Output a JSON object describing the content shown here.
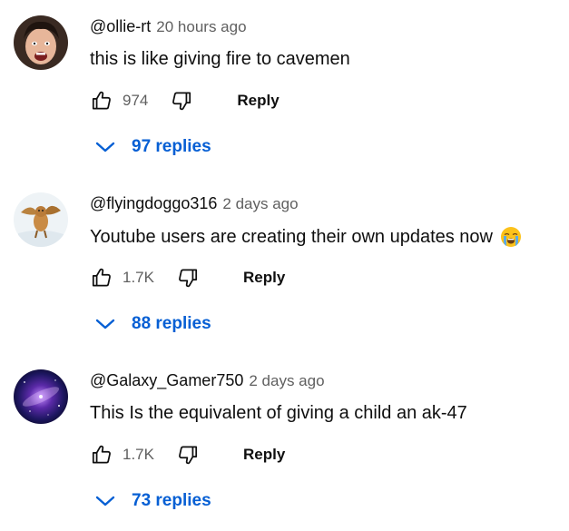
{
  "comments": [
    {
      "author": "@ollie-rt",
      "time": "20 hours ago",
      "text": "this is like giving fire to cavemen",
      "likes": "974",
      "reply_label": "Reply",
      "replies_label": "97 replies",
      "avatar_icon": "face-photo-avatar"
    },
    {
      "author": "@flyingdoggo316",
      "time": "2 days ago",
      "text": "Youtube users are creating their own updates now",
      "emoji": "loudly-crying-face-emoji",
      "likes": "1.7K",
      "reply_label": "Reply",
      "replies_label": "88 replies",
      "avatar_icon": "flying-dog-avatar"
    },
    {
      "author": "@Galaxy_Gamer750",
      "time": "2 days ago",
      "text": "This Is the equivalent of giving a child an ak-47",
      "likes": "1.7K",
      "reply_label": "Reply",
      "replies_label": "73 replies",
      "avatar_icon": "galaxy-avatar"
    }
  ],
  "colors": {
    "replies_blue": "#065fd4",
    "secondary_text": "#606060",
    "primary_text": "#0f0f0f"
  }
}
